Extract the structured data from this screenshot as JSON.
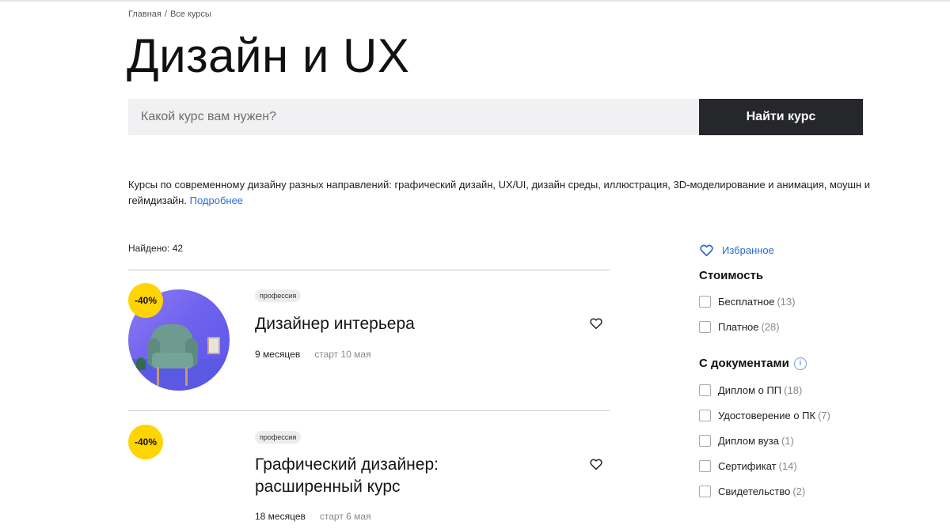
{
  "breadcrumb": {
    "home": "Главная",
    "separator": "/",
    "current": "Все курсы"
  },
  "page_title": "Дизайн и UX",
  "search": {
    "placeholder": "Какой курс вам нужен?",
    "button_label": "Найти курс"
  },
  "description": {
    "text": "Курсы по современному дизайну разных направлений: графический дизайн, UX/UI, дизайн среды, иллюстрация, 3D-моделирование и анимация, моушн и геймдизайн.",
    "more_link": "Подробнее"
  },
  "found": "Найдено: 42",
  "courses": [
    {
      "discount": "-40%",
      "tag": "профессия",
      "title": "Дизайнер интерьера",
      "duration": "9 месяцев",
      "start": "старт 10 мая"
    },
    {
      "discount": "-40%",
      "tag": "профессия",
      "title": "Графический дизайнер: расширенный курс",
      "duration": "18 месяцев",
      "start": "старт 6 мая"
    }
  ],
  "sidebar": {
    "favorites_label": "Избранное",
    "cost": {
      "title": "Стоимость",
      "options": [
        {
          "label": "Бесплатное",
          "count": "(13)"
        },
        {
          "label": "Платное",
          "count": "(28)"
        }
      ]
    },
    "documents": {
      "title": "С документами",
      "info_glyph": "i",
      "options": [
        {
          "label": "Диплом о ПП",
          "count": "(18)"
        },
        {
          "label": "Удостоверение о ПК",
          "count": "(7)"
        },
        {
          "label": "Диплом вуза",
          "count": "(1)"
        },
        {
          "label": "Сертификат",
          "count": "(14)"
        },
        {
          "label": "Свидетельство",
          "count": "(2)"
        }
      ]
    }
  },
  "colors": {
    "accent_link": "#2a6bd8",
    "badge": "#ffd400",
    "button_dark": "#26272b",
    "search_bg": "#f1f1f3"
  }
}
